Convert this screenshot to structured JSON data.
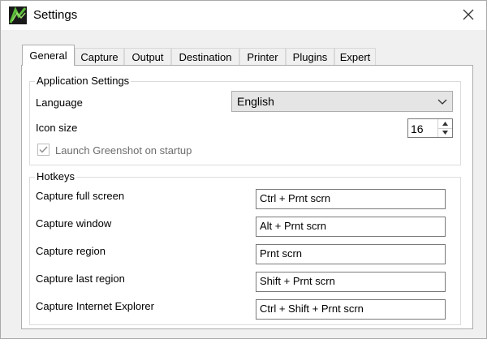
{
  "window": {
    "title": "Settings",
    "icon": "greenshot-app-icon",
    "close_icon": "close-icon"
  },
  "tabs": [
    {
      "label": "General",
      "active": true
    },
    {
      "label": "Capture"
    },
    {
      "label": "Output"
    },
    {
      "label": "Destination"
    },
    {
      "label": "Printer"
    },
    {
      "label": "Plugins"
    },
    {
      "label": "Expert"
    }
  ],
  "app_settings": {
    "legend": "Application Settings",
    "language_label": "Language",
    "language_value": "English",
    "icon_size_label": "Icon size",
    "icon_size_value": "16",
    "launch_label": "Launch Greenshot on startup",
    "launch_checked": true
  },
  "hotkeys": {
    "legend": "Hotkeys",
    "rows": [
      {
        "label": "Capture full screen",
        "value": "Ctrl + Prnt scrn"
      },
      {
        "label": "Capture window",
        "value": "Alt + Prnt scrn"
      },
      {
        "label": "Capture region",
        "value": "Prnt scrn"
      },
      {
        "label": "Capture last region",
        "value": "Shift + Prnt scrn"
      },
      {
        "label": "Capture Internet Explorer",
        "value": "Ctrl + Shift + Prnt scrn"
      }
    ]
  },
  "colors": {
    "window_bg": "#f0f0f0",
    "panel_bg": "#ffffff",
    "border": "#adadad",
    "disabled_text": "#6d6d6d"
  }
}
